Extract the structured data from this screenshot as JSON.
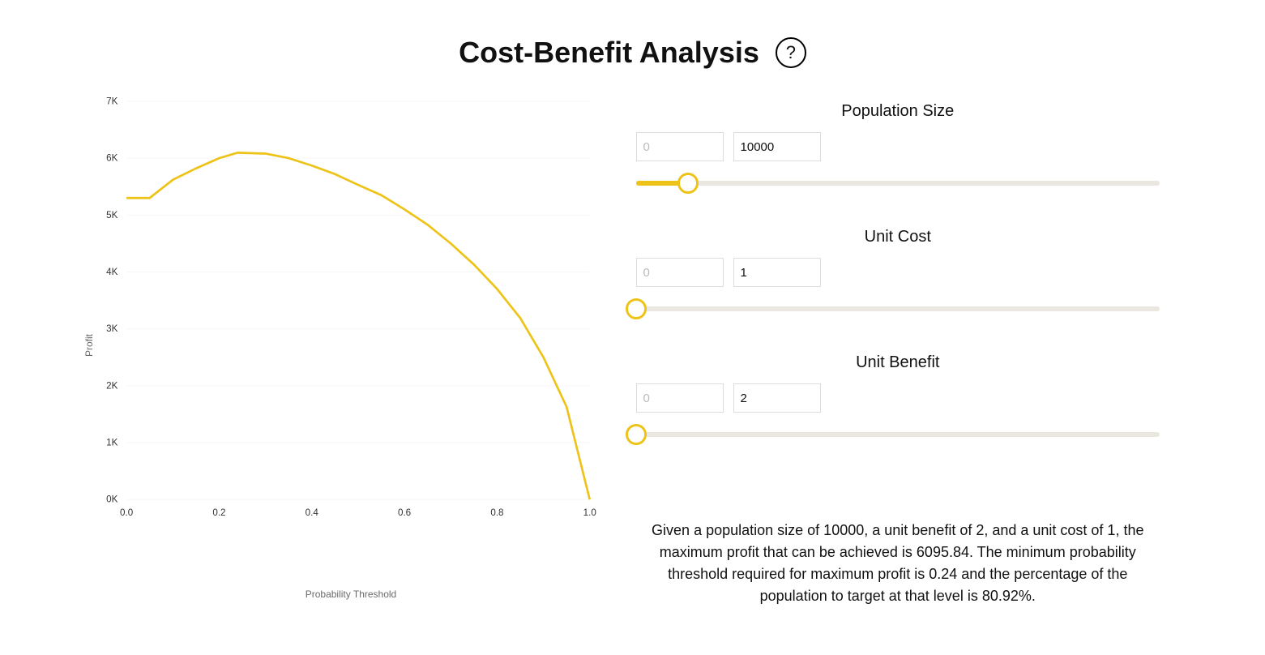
{
  "header": {
    "title": "Cost-Benefit Analysis",
    "help_glyph": "?"
  },
  "chart_data": {
    "type": "line",
    "title": "",
    "xlabel": "Probability Threshold",
    "ylabel": "Profit",
    "xlim": [
      0.0,
      1.0
    ],
    "ylim": [
      0,
      7000
    ],
    "x_ticks": [
      "0.0",
      "0.2",
      "0.4",
      "0.6",
      "0.8",
      "1.0"
    ],
    "y_ticks": [
      "0K",
      "1K",
      "2K",
      "3K",
      "4K",
      "5K",
      "6K",
      "7K"
    ],
    "x": [
      0.0,
      0.05,
      0.1,
      0.15,
      0.2,
      0.24,
      0.3,
      0.35,
      0.4,
      0.45,
      0.5,
      0.55,
      0.6,
      0.65,
      0.7,
      0.75,
      0.8,
      0.85,
      0.9,
      0.95,
      1.0
    ],
    "values": [
      5300,
      5300,
      5620,
      5820,
      6000,
      6095.84,
      6080,
      6000,
      5870,
      5720,
      5530,
      5350,
      5100,
      4830,
      4500,
      4130,
      3700,
      3190,
      2500,
      1630,
      0
    ],
    "series_color": "#edc317"
  },
  "controls": {
    "population": {
      "label": "Population Size",
      "min_placeholder": "0",
      "value": "10000",
      "slider_fill_pct": 10
    },
    "unit_cost": {
      "label": "Unit Cost",
      "min_placeholder": "0",
      "value": "1",
      "slider_fill_pct": 0
    },
    "unit_benefit": {
      "label": "Unit Benefit",
      "min_placeholder": "0",
      "value": "2",
      "slider_fill_pct": 0
    }
  },
  "summary_text": "Given a population size of 10000, a unit benefit of 2, and a unit cost of 1, the maximum profit that can be achieved is 6095.84. The minimum probability threshold required for maximum profit is 0.24 and the percentage of the population to target at that level is 80.92%."
}
